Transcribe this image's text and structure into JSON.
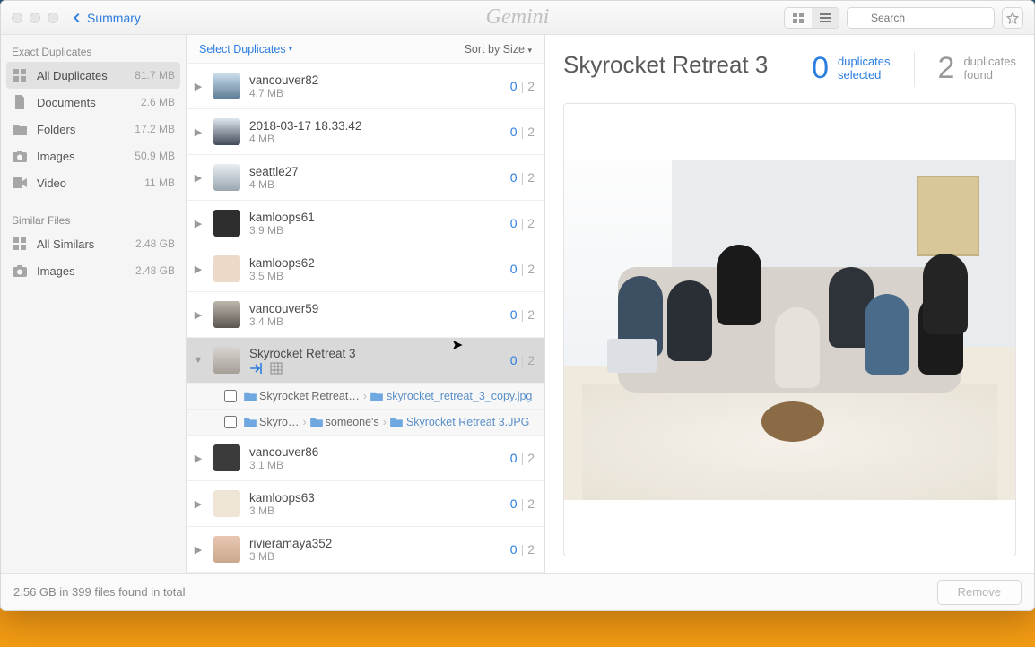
{
  "titlebar": {
    "back_label": "Summary",
    "brand": "Gemini",
    "search_placeholder": "Search"
  },
  "sidebar": {
    "section_exact": "Exact Duplicates",
    "section_similar": "Similar Files",
    "exact": [
      {
        "label": "All Duplicates",
        "size": "81.7 MB",
        "icon": "grid"
      },
      {
        "label": "Documents",
        "size": "2.6 MB",
        "icon": "doc"
      },
      {
        "label": "Folders",
        "size": "17.2 MB",
        "icon": "folder"
      },
      {
        "label": "Images",
        "size": "50.9 MB",
        "icon": "camera"
      },
      {
        "label": "Video",
        "size": "11 MB",
        "icon": "video"
      }
    ],
    "similar": [
      {
        "label": "All Similars",
        "size": "2.48 GB",
        "icon": "grid"
      },
      {
        "label": "Images",
        "size": "2.48 GB",
        "icon": "camera"
      }
    ]
  },
  "mid": {
    "select_label": "Select Duplicates",
    "sort_label": "Sort by Size",
    "groups": [
      {
        "name": "vancouver82",
        "size": "4.7 MB",
        "sel": "0",
        "tot": "2",
        "t": "t0"
      },
      {
        "name": "2018-03-17 18.33.42",
        "size": "4 MB",
        "sel": "0",
        "tot": "2",
        "t": "t1"
      },
      {
        "name": "seattle27",
        "size": "4 MB",
        "sel": "0",
        "tot": "2",
        "t": "t2"
      },
      {
        "name": "kamloops61",
        "size": "3.9 MB",
        "sel": "0",
        "tot": "2",
        "t": "t3"
      },
      {
        "name": "kamloops62",
        "size": "3.5 MB",
        "sel": "0",
        "tot": "2",
        "t": "t4"
      },
      {
        "name": "vancouver59",
        "size": "3.4 MB",
        "sel": "0",
        "tot": "2",
        "t": "t5"
      },
      {
        "name": "Skyrocket Retreat 3",
        "size": "",
        "sel": "0",
        "tot": "2",
        "t": "t6",
        "expanded": true
      },
      {
        "name": "vancouver86",
        "size": "3.1 MB",
        "sel": "0",
        "tot": "2",
        "t": "t7"
      },
      {
        "name": "kamloops63",
        "size": "3 MB",
        "sel": "0",
        "tot": "2",
        "t": "t8"
      },
      {
        "name": "rivieramaya352",
        "size": "3 MB",
        "sel": "0",
        "tot": "2",
        "t": "t9"
      }
    ],
    "children": [
      {
        "path": [
          {
            "f": "Skyrocket Retreat…"
          }
        ],
        "file": "skyrocket_retreat_3_copy.jpg"
      },
      {
        "path": [
          {
            "f": "Skyro…"
          },
          {
            "f": "someone's"
          }
        ],
        "file": "Skyrocket Retreat 3.JPG"
      }
    ]
  },
  "detail": {
    "title": "Skyrocket Retreat 3",
    "sel_n": "0",
    "sel_l1": "duplicates",
    "sel_l2": "selected",
    "fnd_n": "2",
    "fnd_l1": "duplicates",
    "fnd_l2": "found"
  },
  "footer": {
    "status": "2.56 GB in 399 files found in total",
    "remove": "Remove"
  }
}
